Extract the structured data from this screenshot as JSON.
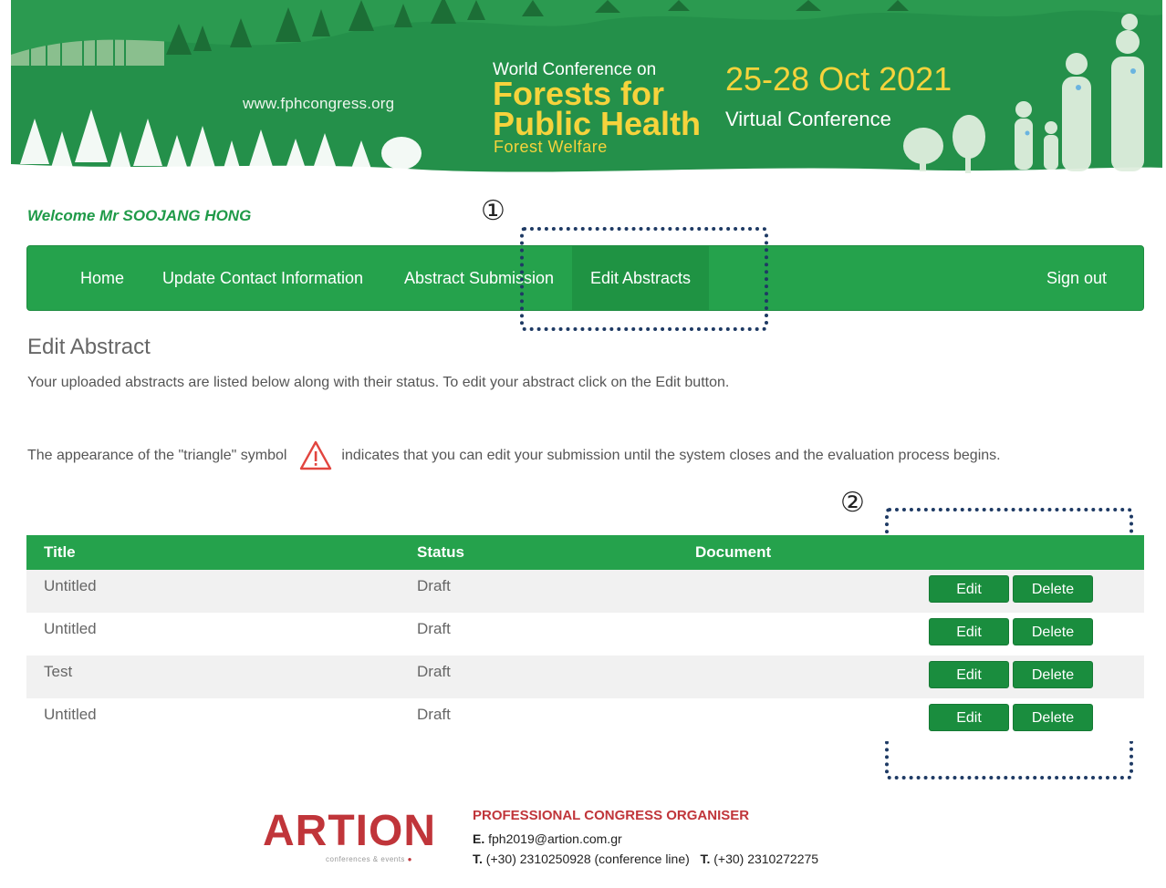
{
  "banner": {
    "site_url": "www.fphcongress.org",
    "conf_pre": "World Conference on",
    "conf_title": "Forests for Public Health",
    "conf_sub": "Forest Welfare",
    "conf_date": "25-28 Oct 2021",
    "conf_mode": "Virtual Conference"
  },
  "welcome": "Welcome Mr SOOJANG HONG",
  "nav": {
    "home": "Home",
    "update_contact": "Update Contact Information",
    "abstract_submission": "Abstract Submission",
    "edit_abstracts": "Edit Abstracts",
    "sign_out": "Sign out"
  },
  "annotations": {
    "one": "①",
    "two": "②"
  },
  "content": {
    "title": "Edit Abstract",
    "intro": "Your uploaded abstracts are listed below along with their status. To edit your abstract click on the Edit button.",
    "triangle_before": "The appearance of the \"triangle\" symbol",
    "triangle_after": "indicates that you can edit your submission until the system closes and the evaluation process begins."
  },
  "table": {
    "headers": {
      "title": "Title",
      "status": "Status",
      "document": "Document"
    },
    "rows": [
      {
        "title": "Untitled",
        "status": "Draft"
      },
      {
        "title": "Untitled",
        "status": "Draft"
      },
      {
        "title": "Test",
        "status": "Draft"
      },
      {
        "title": "Untitled",
        "status": "Draft"
      }
    ],
    "edit_label": "Edit",
    "delete_label": "Delete"
  },
  "footer": {
    "logo": "ARTION",
    "tagline": "conferences & events",
    "role": "PROFESSIONAL CONGRESS ORGANISER",
    "email_label": "E.",
    "email": "fph2019@artion.com.gr",
    "phone_label": "T.",
    "phone1": "(+30) 2310250928 (conference line)",
    "phone_label2": "T.",
    "phone2": "(+30) 2310272275"
  },
  "colors": {
    "brand_green": "#25a24c",
    "banner_green": "#24904a",
    "accent_yellow": "#f6d33c",
    "artion_red": "#c0353a",
    "annotation_navy": "#1e3a64"
  }
}
